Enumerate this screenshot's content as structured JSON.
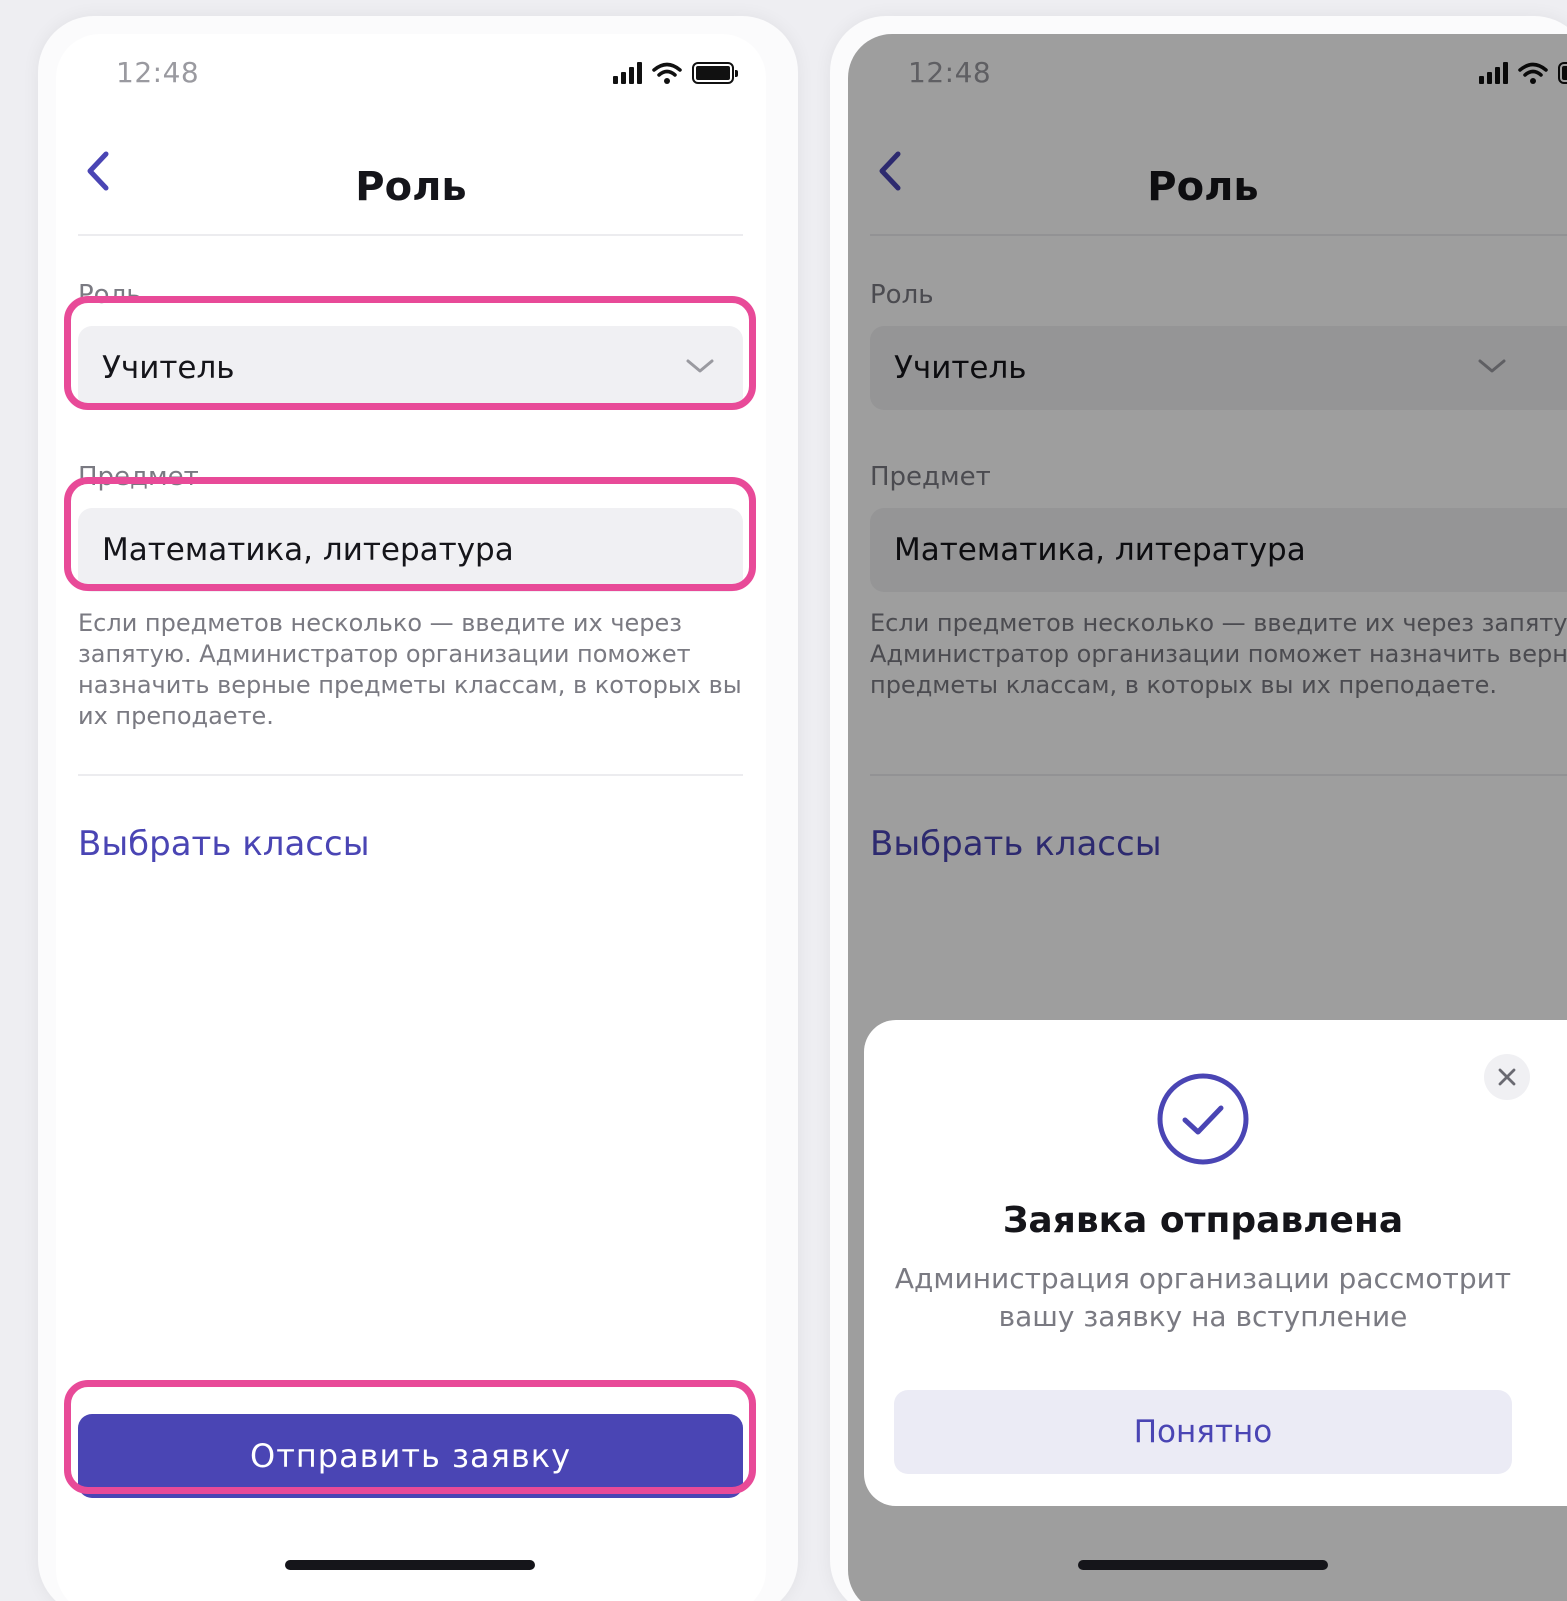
{
  "status_bar": {
    "time": "12:48"
  },
  "header": {
    "title": "Роль"
  },
  "form": {
    "role_label": "Роль",
    "role_value": "Учитель",
    "subject_label": "Предмет",
    "subject_value": "Математика, литература",
    "subject_hint": "Если предметов несколько — введите их через запятую. Администратор организации поможет назначить верные предметы классам, в которых вы их преподаете.",
    "choose_classes_link": "Выбрать классы"
  },
  "submit_button": "Отправить заявку",
  "dialog": {
    "title": "Заявка отправлена",
    "description": "Администрация организации рассмотрит вашу заявку на вступление",
    "ok_button": "Понятно"
  },
  "colors": {
    "accent": "#4a45b4",
    "highlight": "#e84a98",
    "field_bg": "#f0f0f3"
  }
}
